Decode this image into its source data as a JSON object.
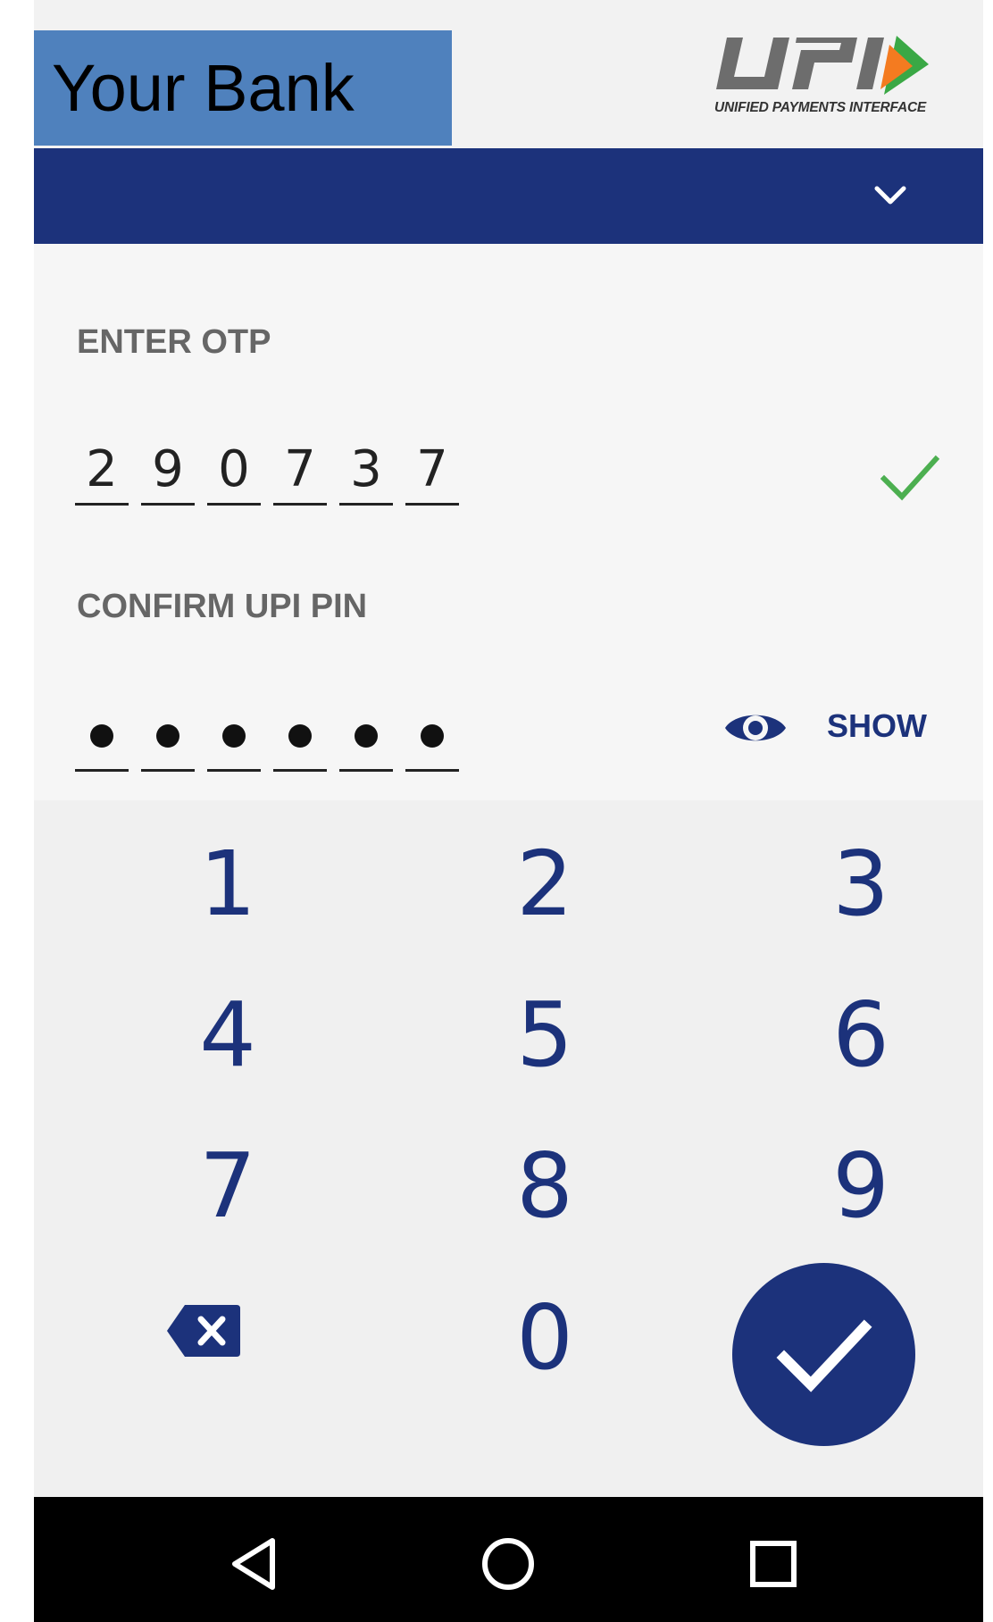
{
  "header": {
    "bank_name": "Your Bank",
    "logo_text": "UPI",
    "logo_tagline": "UNIFIED PAYMENTS INTERFACE"
  },
  "otp": {
    "label": "ENTER OTP",
    "digits": [
      "2",
      "9",
      "0",
      "7",
      "3",
      "7"
    ]
  },
  "pin": {
    "label": "CONFIRM UPI PIN",
    "length": 6,
    "show_label": "SHOW"
  },
  "keypad": {
    "keys": [
      "1",
      "2",
      "3",
      "4",
      "5",
      "6",
      "7",
      "8",
      "9",
      "0"
    ]
  },
  "icons": {
    "chevron": "chevron-down-icon",
    "otp_valid": "check-icon",
    "show_pin": "eye-icon",
    "delete": "backspace-icon",
    "submit": "check-icon",
    "nav": [
      "back-icon",
      "home-icon",
      "recents-icon"
    ]
  },
  "colors": {
    "primary": "#1c327b",
    "bank_box": "#4f81bd",
    "success": "#4caf50",
    "upi_green": "#3aa845",
    "upi_orange": "#f47b20"
  }
}
